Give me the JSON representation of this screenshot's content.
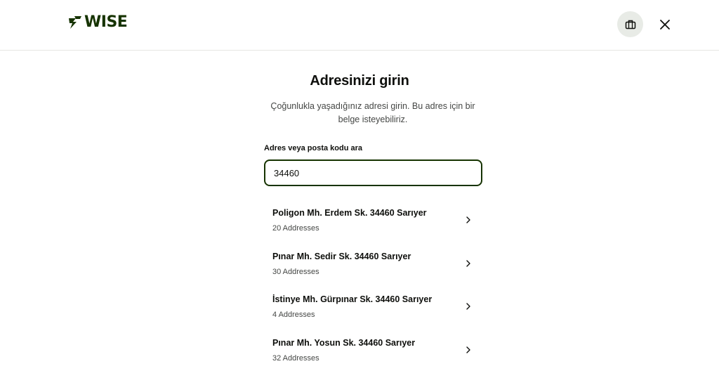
{
  "header": {
    "logo_text": "WISE",
    "briefcase_icon": "briefcase-icon",
    "close_icon": "close-icon"
  },
  "page": {
    "title": "Adresinizi girin",
    "subtitle": "Çoğunlukla yaşadığınız adresi girin. Bu adres için bir belge isteyebiliriz."
  },
  "search": {
    "label": "Adres veya posta kodu ara",
    "value": "34460"
  },
  "results": [
    {
      "title": "Poligon Mh. Erdem Sk. 34460 Sarıyer",
      "count": "20 Addresses"
    },
    {
      "title": "Pınar Mh. Sedir Sk. 34460 Sarıyer",
      "count": "30 Addresses"
    },
    {
      "title": "İstinye Mh. Gürpınar Sk. 34460 Sarıyer",
      "count": "4 Addresses"
    },
    {
      "title": "Pınar Mh. Yosun Sk. 34460 Sarıyer",
      "count": "32 Addresses"
    }
  ],
  "colors": {
    "brand": "#163300",
    "text": "#0e0f0c",
    "muted": "#454745",
    "icon_button_bg": "#e8ebe6"
  }
}
